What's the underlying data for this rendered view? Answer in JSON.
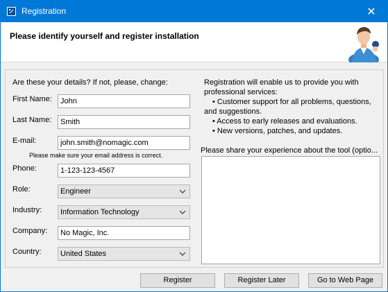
{
  "window": {
    "title": "Registration",
    "app_icon": "magicdraw-icon",
    "close_icon": "close-icon",
    "close_glyph": "✕"
  },
  "header": {
    "heading": "Please identify yourself and register installation",
    "avatar_icon": "user-avatar-icon"
  },
  "form": {
    "intro": "Are these your details? If not, please, change:",
    "first_name": {
      "label": "First Name:",
      "value": "John"
    },
    "last_name": {
      "label": "Last Name:",
      "value": "Smith"
    },
    "email": {
      "label": "E-mail:",
      "value": "john.smith@nomagic.com",
      "hint": "Please make sure your email address is correct."
    },
    "phone": {
      "label": "Phone:",
      "value": "1-123-123-4567"
    },
    "role": {
      "label": "Role:",
      "value": "Engineer"
    },
    "industry": {
      "label": "Industry:",
      "value": "Information Technology"
    },
    "company": {
      "label": "Company:",
      "value": "No Magic, Inc."
    },
    "country": {
      "label": "Country:",
      "value": "United States"
    }
  },
  "info": {
    "line1": "Registration will enable us to provide you with",
    "line2": "professional services:",
    "bullet1a": "• Customer support for all problems, questions,",
    "bullet1b": "and suggestions.",
    "bullet2": "• Access to early releases and evaluations.",
    "bullet3": "• New versions, patches, and updates.",
    "feedback_label": "Please share your experience about the tool (optio..."
  },
  "buttons": {
    "register": "Register",
    "register_later": "Register Later",
    "web_page": "Go to Web Page"
  },
  "colors": {
    "titlebar": "#0078d7",
    "panel": "#f0f0f0"
  }
}
